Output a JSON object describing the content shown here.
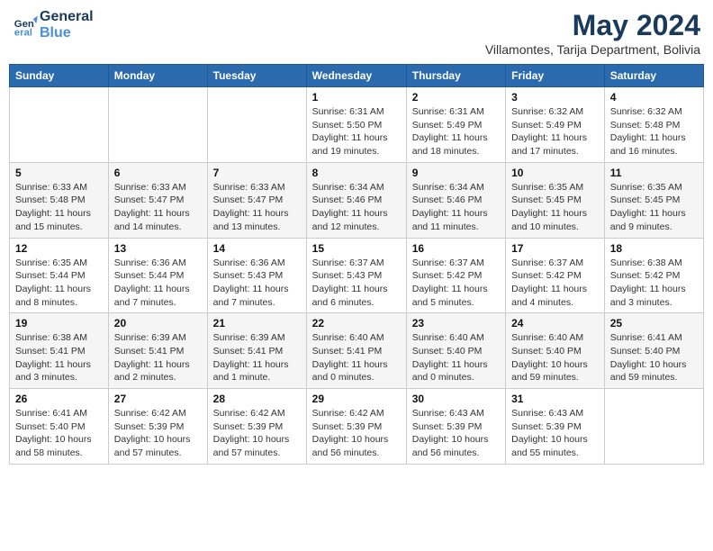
{
  "header": {
    "logo_line1": "General",
    "logo_line2": "Blue",
    "month": "May 2024",
    "location": "Villamontes, Tarija Department, Bolivia"
  },
  "weekdays": [
    "Sunday",
    "Monday",
    "Tuesday",
    "Wednesday",
    "Thursday",
    "Friday",
    "Saturday"
  ],
  "weeks": [
    [
      {
        "day": "",
        "info": ""
      },
      {
        "day": "",
        "info": ""
      },
      {
        "day": "",
        "info": ""
      },
      {
        "day": "1",
        "info": "Sunrise: 6:31 AM\nSunset: 5:50 PM\nDaylight: 11 hours and 19 minutes."
      },
      {
        "day": "2",
        "info": "Sunrise: 6:31 AM\nSunset: 5:49 PM\nDaylight: 11 hours and 18 minutes."
      },
      {
        "day": "3",
        "info": "Sunrise: 6:32 AM\nSunset: 5:49 PM\nDaylight: 11 hours and 17 minutes."
      },
      {
        "day": "4",
        "info": "Sunrise: 6:32 AM\nSunset: 5:48 PM\nDaylight: 11 hours and 16 minutes."
      }
    ],
    [
      {
        "day": "5",
        "info": "Sunrise: 6:33 AM\nSunset: 5:48 PM\nDaylight: 11 hours and 15 minutes."
      },
      {
        "day": "6",
        "info": "Sunrise: 6:33 AM\nSunset: 5:47 PM\nDaylight: 11 hours and 14 minutes."
      },
      {
        "day": "7",
        "info": "Sunrise: 6:33 AM\nSunset: 5:47 PM\nDaylight: 11 hours and 13 minutes."
      },
      {
        "day": "8",
        "info": "Sunrise: 6:34 AM\nSunset: 5:46 PM\nDaylight: 11 hours and 12 minutes."
      },
      {
        "day": "9",
        "info": "Sunrise: 6:34 AM\nSunset: 5:46 PM\nDaylight: 11 hours and 11 minutes."
      },
      {
        "day": "10",
        "info": "Sunrise: 6:35 AM\nSunset: 5:45 PM\nDaylight: 11 hours and 10 minutes."
      },
      {
        "day": "11",
        "info": "Sunrise: 6:35 AM\nSunset: 5:45 PM\nDaylight: 11 hours and 9 minutes."
      }
    ],
    [
      {
        "day": "12",
        "info": "Sunrise: 6:35 AM\nSunset: 5:44 PM\nDaylight: 11 hours and 8 minutes."
      },
      {
        "day": "13",
        "info": "Sunrise: 6:36 AM\nSunset: 5:44 PM\nDaylight: 11 hours and 7 minutes."
      },
      {
        "day": "14",
        "info": "Sunrise: 6:36 AM\nSunset: 5:43 PM\nDaylight: 11 hours and 7 minutes."
      },
      {
        "day": "15",
        "info": "Sunrise: 6:37 AM\nSunset: 5:43 PM\nDaylight: 11 hours and 6 minutes."
      },
      {
        "day": "16",
        "info": "Sunrise: 6:37 AM\nSunset: 5:42 PM\nDaylight: 11 hours and 5 minutes."
      },
      {
        "day": "17",
        "info": "Sunrise: 6:37 AM\nSunset: 5:42 PM\nDaylight: 11 hours and 4 minutes."
      },
      {
        "day": "18",
        "info": "Sunrise: 6:38 AM\nSunset: 5:42 PM\nDaylight: 11 hours and 3 minutes."
      }
    ],
    [
      {
        "day": "19",
        "info": "Sunrise: 6:38 AM\nSunset: 5:41 PM\nDaylight: 11 hours and 3 minutes."
      },
      {
        "day": "20",
        "info": "Sunrise: 6:39 AM\nSunset: 5:41 PM\nDaylight: 11 hours and 2 minutes."
      },
      {
        "day": "21",
        "info": "Sunrise: 6:39 AM\nSunset: 5:41 PM\nDaylight: 11 hours and 1 minute."
      },
      {
        "day": "22",
        "info": "Sunrise: 6:40 AM\nSunset: 5:41 PM\nDaylight: 11 hours and 0 minutes."
      },
      {
        "day": "23",
        "info": "Sunrise: 6:40 AM\nSunset: 5:40 PM\nDaylight: 11 hours and 0 minutes."
      },
      {
        "day": "24",
        "info": "Sunrise: 6:40 AM\nSunset: 5:40 PM\nDaylight: 10 hours and 59 minutes."
      },
      {
        "day": "25",
        "info": "Sunrise: 6:41 AM\nSunset: 5:40 PM\nDaylight: 10 hours and 59 minutes."
      }
    ],
    [
      {
        "day": "26",
        "info": "Sunrise: 6:41 AM\nSunset: 5:40 PM\nDaylight: 10 hours and 58 minutes."
      },
      {
        "day": "27",
        "info": "Sunrise: 6:42 AM\nSunset: 5:39 PM\nDaylight: 10 hours and 57 minutes."
      },
      {
        "day": "28",
        "info": "Sunrise: 6:42 AM\nSunset: 5:39 PM\nDaylight: 10 hours and 57 minutes."
      },
      {
        "day": "29",
        "info": "Sunrise: 6:42 AM\nSunset: 5:39 PM\nDaylight: 10 hours and 56 minutes."
      },
      {
        "day": "30",
        "info": "Sunrise: 6:43 AM\nSunset: 5:39 PM\nDaylight: 10 hours and 56 minutes."
      },
      {
        "day": "31",
        "info": "Sunrise: 6:43 AM\nSunset: 5:39 PM\nDaylight: 10 hours and 55 minutes."
      },
      {
        "day": "",
        "info": ""
      }
    ]
  ]
}
